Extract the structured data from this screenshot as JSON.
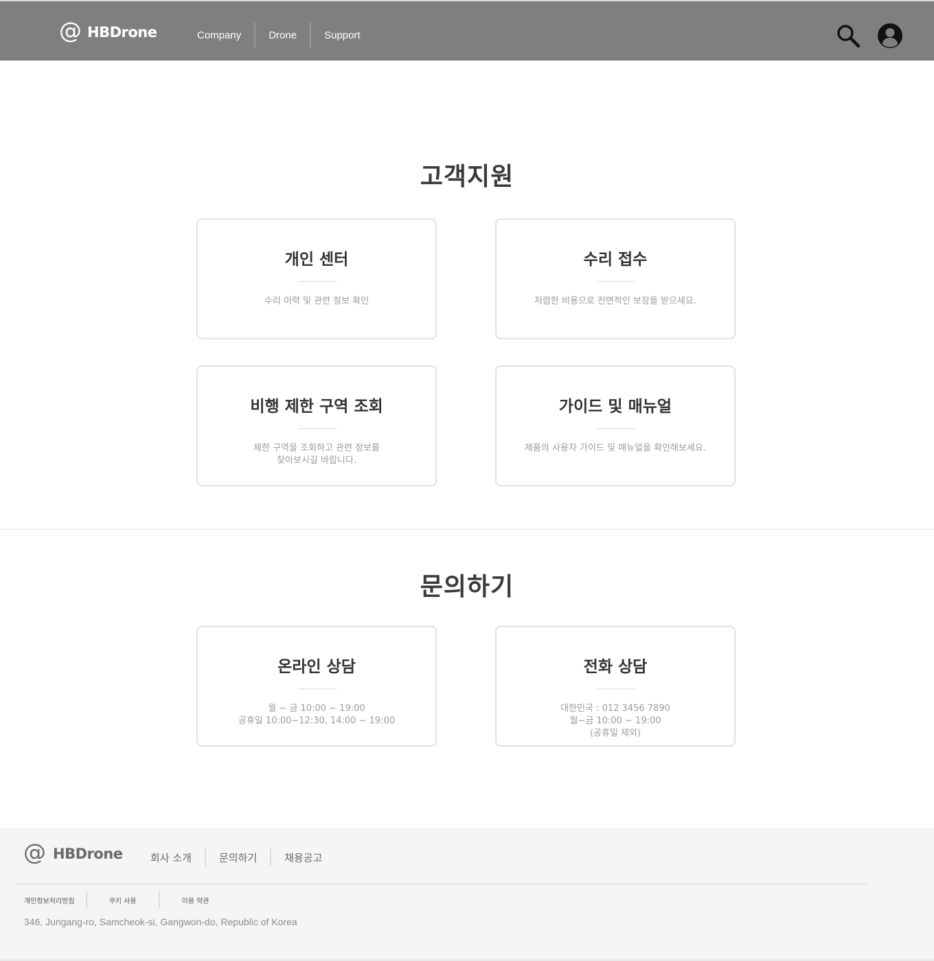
{
  "header": {
    "logo_symbol": "@",
    "brand": "HBDrone",
    "nav": [
      "Company",
      "Drone",
      "Support"
    ],
    "icons": [
      "search-icon",
      "user-icon"
    ]
  },
  "support": {
    "title": "고객지원",
    "cards": [
      {
        "title": "개인 센터",
        "desc": [
          "수리 이력 및 관련 정보 확인"
        ]
      },
      {
        "title": "수리 접수",
        "desc": [
          "저렴한 비용으로 전면적인 보장을 받으세요."
        ]
      },
      {
        "title": "비행 제한 구역 조회",
        "desc": [
          "제한 구역을 조회하고 관련 정보를",
          "찾아보시길 바랍니다."
        ]
      },
      {
        "title": "가이드 및 매뉴얼",
        "desc": [
          "제품의 사용자 가이드 및 매뉴얼을 확인해보세요."
        ]
      }
    ]
  },
  "inquiry": {
    "title": "문의하기",
    "cards": [
      {
        "title": "온라인 상담",
        "desc": [
          "월 ~ 금 10:00 ~ 19:00",
          "공휴일 10:00~12:30, 14:00 ~ 19:00"
        ]
      },
      {
        "title": "전화 상담",
        "desc": [
          "대한민국 : 012 3456 7890",
          "월~금 10:00 ~ 19:00",
          "(공휴일 제외)"
        ]
      }
    ]
  },
  "footer": {
    "logo_symbol": "@",
    "brand": "HBDrone",
    "nav": [
      "회사 소개",
      "문의하기",
      "채용공고"
    ],
    "links": [
      "개인정보처리방침",
      "쿠키 사용",
      "이용 약관"
    ],
    "address": "346, Jungang-ro, Samcheok-si, Gangwon-do, Republic of Korea"
  },
  "colors": {
    "header_bg": "#7f7f7f",
    "footer_bg": "#f5f5f5",
    "card_border": "#e1e1e1"
  }
}
